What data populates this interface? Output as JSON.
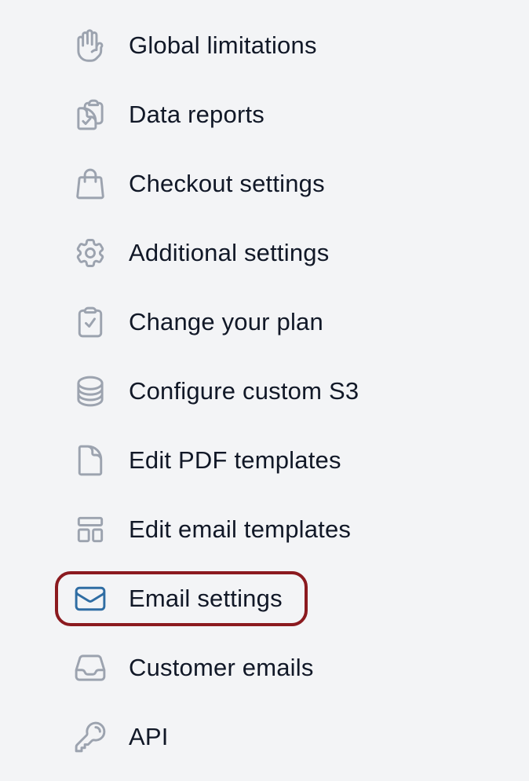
{
  "menu": {
    "items": [
      {
        "label": "Global limitations",
        "icon": "hand-icon"
      },
      {
        "label": "Data reports",
        "icon": "clipboard-copy-icon"
      },
      {
        "label": "Checkout settings",
        "icon": "shopping-bag-icon"
      },
      {
        "label": "Additional settings",
        "icon": "gear-icon"
      },
      {
        "label": "Change your plan",
        "icon": "clipboard-check-icon"
      },
      {
        "label": "Configure custom S3",
        "icon": "database-icon"
      },
      {
        "label": "Edit PDF templates",
        "icon": "document-icon"
      },
      {
        "label": "Edit email templates",
        "icon": "template-layout-icon"
      },
      {
        "label": "Email settings",
        "icon": "envelope-icon",
        "active": true
      },
      {
        "label": "Customer emails",
        "icon": "inbox-tray-icon"
      },
      {
        "label": "API",
        "icon": "key-icon"
      }
    ],
    "active_icon_color": "#2f6da3",
    "highlight_color": "#8b1a1f"
  }
}
